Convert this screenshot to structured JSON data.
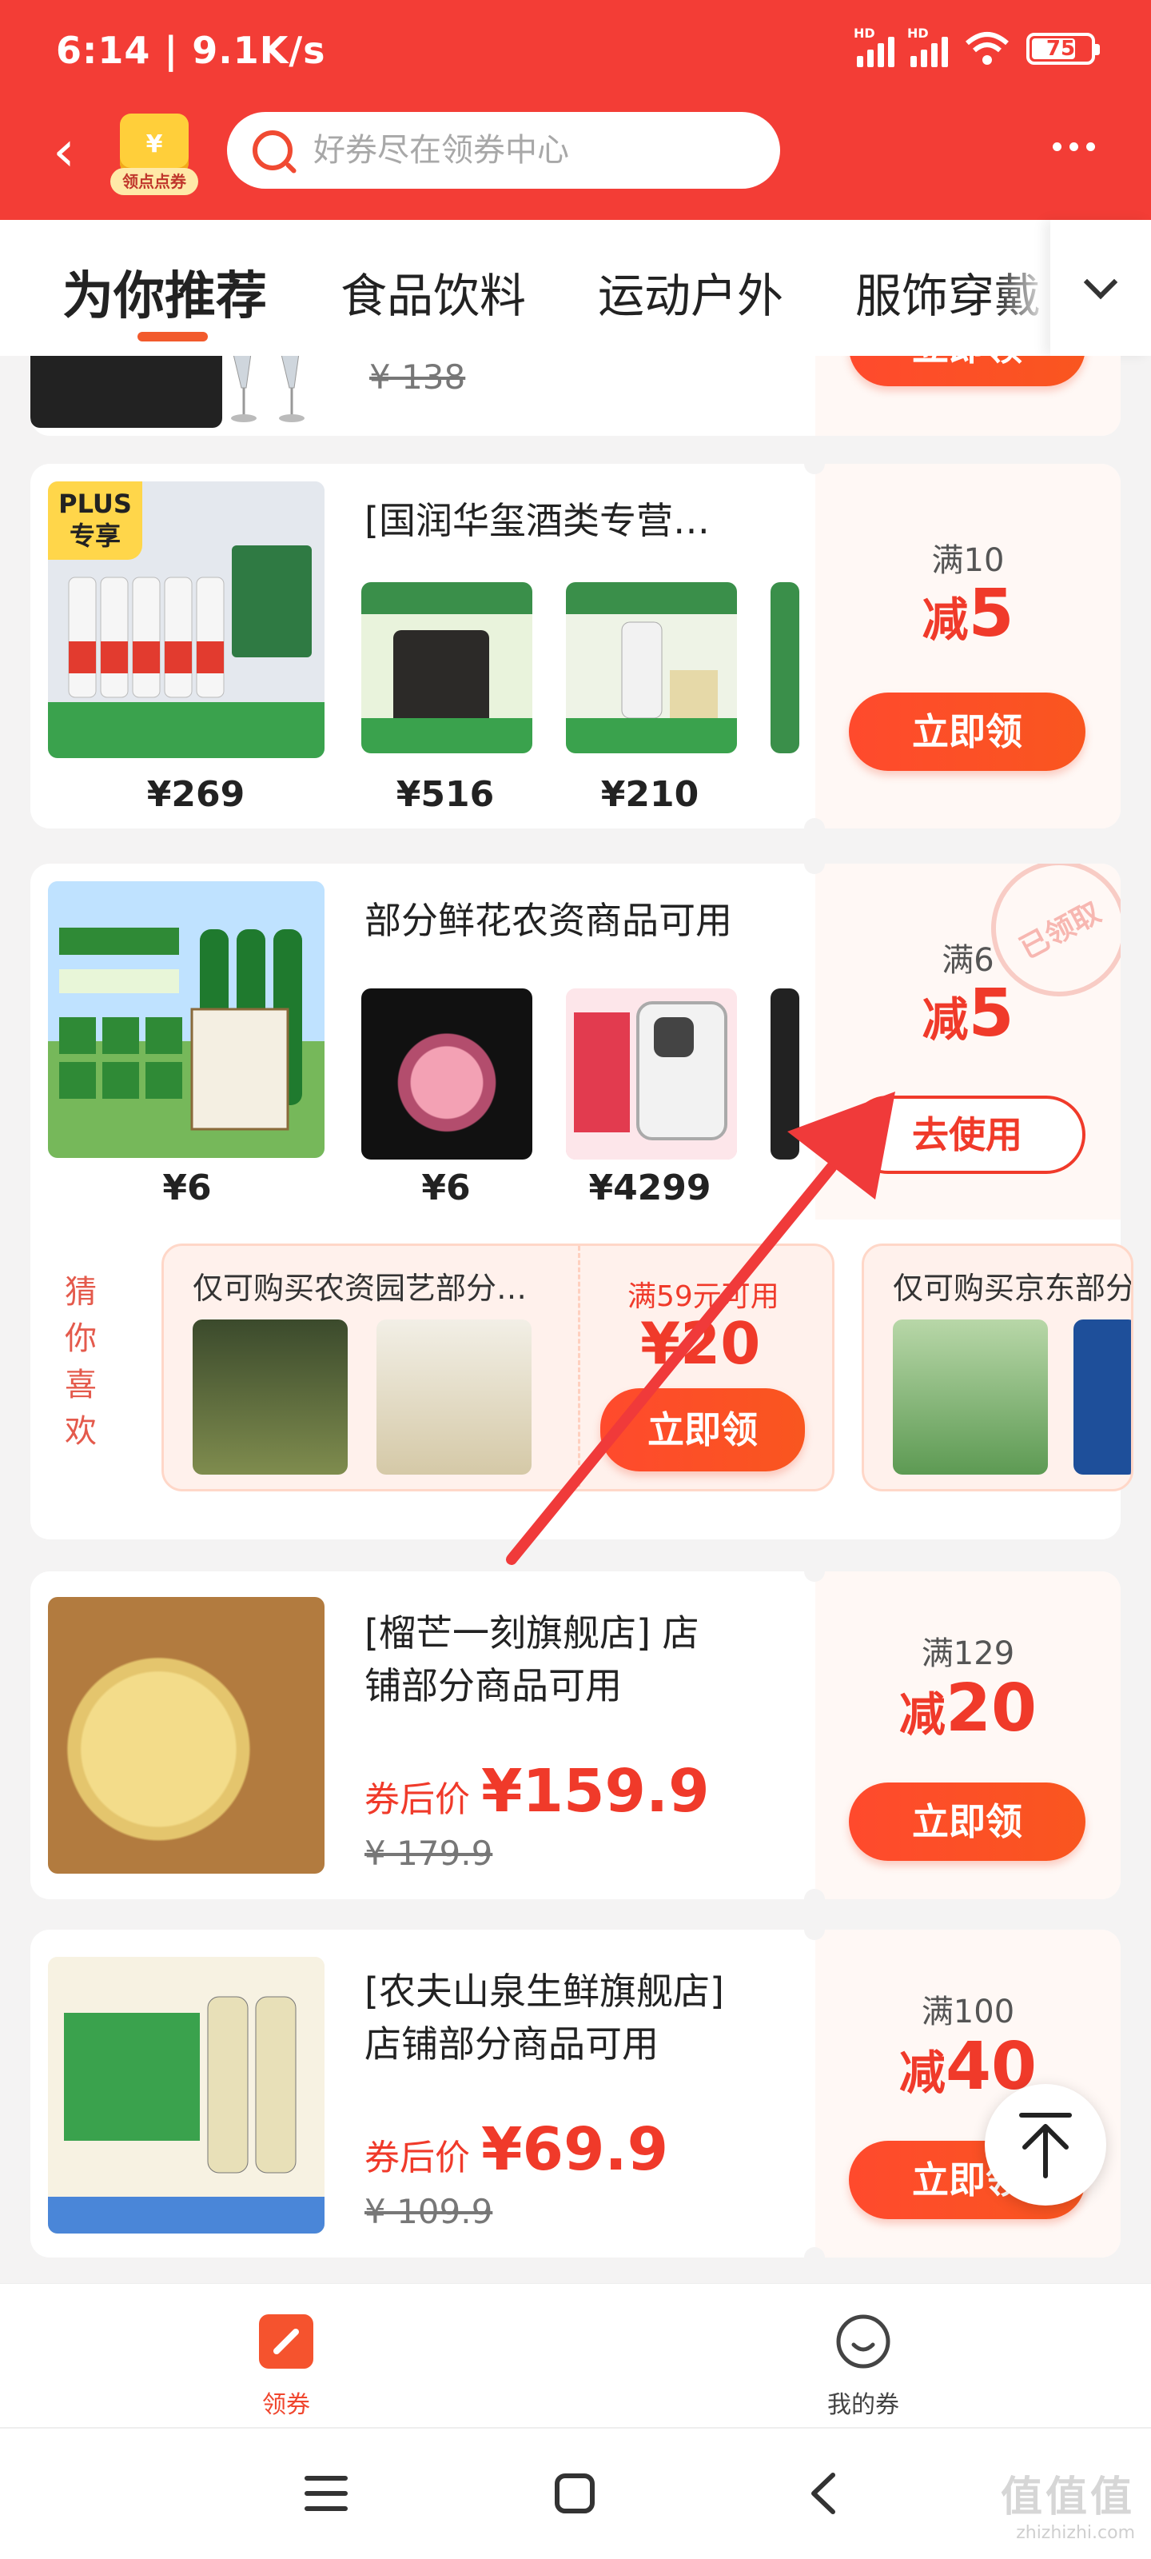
{
  "status_bar": {
    "time": "6:14 | 9.1K/s",
    "battery": "75",
    "battery_level": 0.75,
    "signal_labels": [
      "HD",
      "HD"
    ]
  },
  "header": {
    "back_icon": "back-icon",
    "points_badge": "领点点券",
    "points_coin": "¥",
    "search_placeholder": "好券尽在领券中心",
    "menu_icon": "more-icon"
  },
  "tabs": [
    {
      "label": "为你推荐",
      "active": true
    },
    {
      "label": "食品饮料",
      "active": false
    },
    {
      "label": "运动户外",
      "active": false
    },
    {
      "label": "服饰穿戴",
      "active": false
    }
  ],
  "cards": {
    "top_partial": {
      "orig_price": "¥ 138",
      "button": "立即领"
    },
    "liquor": {
      "title": "[国润华玺酒类专营…",
      "badge": "PLUS\n专享",
      "prices": [
        "¥269",
        "¥516",
        "¥210"
      ],
      "condition": "满10",
      "discount_prefix": "减",
      "discount_value": "5",
      "button": "立即领"
    },
    "flower": {
      "title": "部分鲜花农资商品可用",
      "prices": [
        "¥6",
        "¥6",
        "¥4299"
      ],
      "condition": "满6",
      "discount_prefix": "减",
      "discount_value": "5",
      "button": "去使用",
      "stamp": "已领取"
    },
    "guess": {
      "label": "猜你喜欢",
      "item1": {
        "title": "仅可购买农资园艺部分…",
        "condition": "满59元可用",
        "value": "¥20",
        "button": "立即领"
      },
      "item2": {
        "title": "仅可购买京东部分"
      }
    },
    "crepe": {
      "title_line1": "[榴芒一刻旗舰店] 店",
      "title_line2": "铺部分商品可用",
      "after_label": "券后价",
      "after_price": "¥159.9",
      "orig_price": "¥ 179.9",
      "condition": "满129",
      "discount_prefix": "减",
      "discount_value": "20",
      "button": "立即领"
    },
    "nfc": {
      "title_line1": "[农夫山泉生鲜旗舰店]",
      "title_line2": "店铺部分商品可用",
      "after_label": "券后价",
      "after_price": "¥69.9",
      "orig_price": "¥ 109.9",
      "condition": "满100",
      "discount_prefix": "减",
      "discount_value": "40",
      "button": "立即领"
    }
  },
  "bottom_nav": [
    {
      "label": "领券",
      "active": true,
      "icon": "coupon-icon"
    },
    {
      "label": "我的券",
      "active": false,
      "icon": "my-coupon-icon"
    }
  ],
  "watermark": {
    "line1": "值值值",
    "line2": "zhizhizhi.com"
  },
  "colors": {
    "brand": "#f33d36",
    "accent": "#f03a2a",
    "bg": "#f4f3f3"
  }
}
